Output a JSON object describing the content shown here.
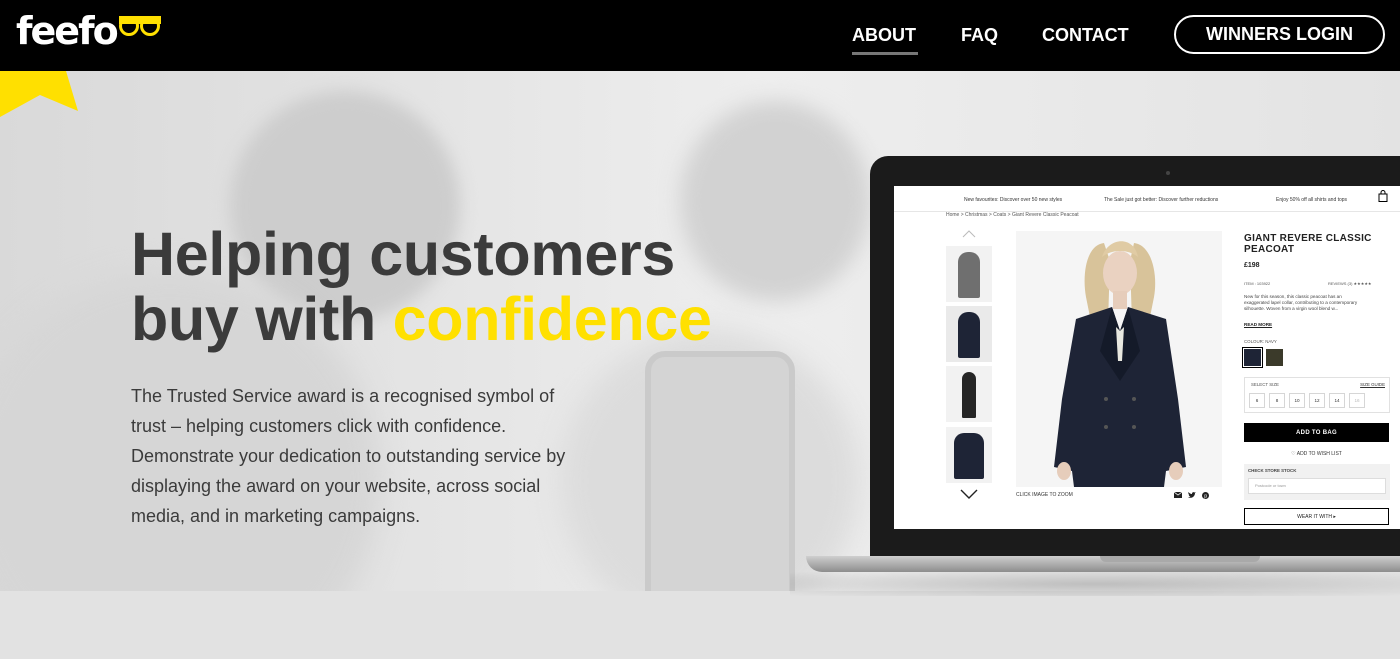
{
  "header": {
    "logo_text": "feefo",
    "nav": [
      {
        "label": "ABOUT"
      },
      {
        "label": "FAQ"
      },
      {
        "label": "CONTACT"
      }
    ],
    "login_label": "WINNERS LOGIN"
  },
  "hero": {
    "title_line1": "Helping customers",
    "title_line2_prefix": "buy with",
    "title_accent": "confidence",
    "body": "The Trusted Service award is a recognised symbol of trust – helping customers click with confidence. Demonstrate your dedication to outstanding service by displaying the award on your website, across social media, and in marketing campaigns."
  },
  "mockup": {
    "promos": [
      "New favourites: Discover over 50 new styles",
      "The Sale just got better: Discover further reductions",
      "Enjoy 50% off all shirts and tops"
    ],
    "breadcrumb": "Home  >  Christmas  >  Coats  >  Giant Revere Classic Peacoat",
    "product_title": "GIANT REVERE CLASSIC PEACOAT",
    "price": "£198",
    "item": "ITEM : 103922",
    "reviews": "REVIEWS (3)  ★★★★★",
    "description": "New for this season, this classic peacoat has an exaggerated lapel collar, contributing to a contemporary silhouette. Woven from a virgin wool blend w...",
    "read_more": "READ MORE",
    "colour_label": "COLOUR: NAVY",
    "select_size": "SELECT SIZE",
    "size_guide": "SIZE GUIDE",
    "sizes": [
      "6",
      "8",
      "10",
      "12",
      "14",
      "16"
    ],
    "add_to_bag": "ADD TO BAG",
    "wish_list": "♡  ADD TO WISH LIST",
    "check_stock": "CHECK STORE STOCK",
    "postcode_placeholder": "Postcode or town",
    "wear_it_with": "WEAR IT WITH  ▸",
    "zoom_note": "CLICK IMAGE TO ZOOM"
  },
  "colors": {
    "header_bg": "#000000",
    "accent_yellow": "#ffe000",
    "text_dark": "#3b3b3b",
    "coat_navy": "#1e2436"
  }
}
